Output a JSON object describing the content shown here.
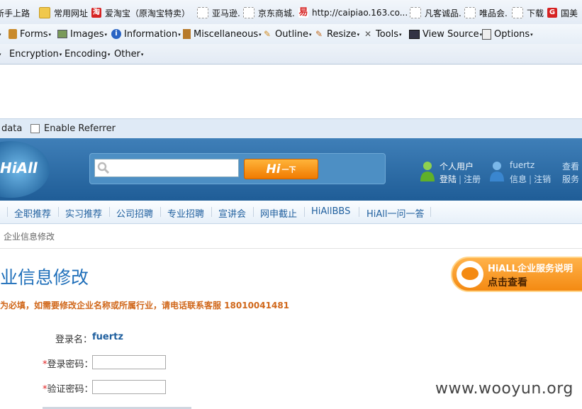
{
  "bookmarks": [
    {
      "label": "新手上路",
      "icon": "page-icon"
    },
    {
      "label": "常用网址",
      "icon": "folder-icon"
    },
    {
      "label": "爱淘宝（原淘宝特卖）",
      "icon": "taobao-icon",
      "glyph": "淘"
    },
    {
      "label": "亚马逊.",
      "icon": "page-icon"
    },
    {
      "label": "京东商城.",
      "icon": "page-icon"
    },
    {
      "label": "http://caipiao.163.co...",
      "icon": "netease-icon",
      "glyph": "易"
    },
    {
      "label": "凡客诚品.",
      "icon": "page-icon"
    },
    {
      "label": "唯品会.",
      "icon": "page-icon"
    },
    {
      "label": "下载",
      "icon": "page-icon"
    },
    {
      "label": "国美",
      "icon": "gome-icon",
      "glyph": "G"
    }
  ],
  "toolbar1": [
    {
      "label": "Forms",
      "icon": "clipboard-icon"
    },
    {
      "label": "Images",
      "icon": "image-icon"
    },
    {
      "label": "Information",
      "icon": "info-icon"
    },
    {
      "label": "Miscellaneous",
      "icon": "book-icon"
    },
    {
      "label": "Outline",
      "icon": "pencil-icon"
    },
    {
      "label": "Resize",
      "icon": "ruler-icon"
    },
    {
      "label": "Tools",
      "icon": "tools-icon"
    },
    {
      "label": "View Source",
      "icon": "monitor-icon"
    },
    {
      "label": "Options",
      "icon": "options-icon"
    }
  ],
  "toolbar2": [
    {
      "label": "Encryption"
    },
    {
      "label": "Encoding"
    },
    {
      "label": "Other"
    }
  ],
  "referrer_bar": {
    "data_label": "data",
    "enable_referrer": "Enable Referrer"
  },
  "header": {
    "logo_text": "HiAll",
    "search_placeholder": "",
    "hi_button": {
      "main": "Hi",
      "sub": "一下"
    },
    "personal": {
      "title": "个人用户",
      "login": "登陆",
      "register": "注册"
    },
    "user": {
      "name": "fuertz",
      "info": "信息",
      "logout": "注销"
    },
    "extra": {
      "line1": "查看",
      "line2": "服务"
    }
  },
  "nav": [
    "全职推荐",
    "实习推荐",
    "公司招聘",
    "专业招聘",
    "宣讲会",
    "网申截止",
    "HiAllBBS",
    "HiAll一问一答"
  ],
  "breadcrumb": "企业信息修改",
  "page_title": "业信息修改",
  "notice": "为必填，如需要修改企业名称或所属行业，请电话联系客服 18010041481",
  "form": {
    "login_label": "登录名：",
    "login_value": "fuertz",
    "password_label": "登录密码：",
    "confirm_label": "验证密码：",
    "required_mark": "*"
  },
  "service_banner": {
    "line1": "HiALL企业服务说明",
    "line2": "点击查看"
  },
  "watermark": "www.wooyun.org",
  "colors": {
    "header_blue": "#2a6aa3",
    "nav_text": "#1f5f9e",
    "notice_orange": "#d0671a",
    "title_blue": "#1f6fba",
    "accent_orange": "#f48a12"
  }
}
